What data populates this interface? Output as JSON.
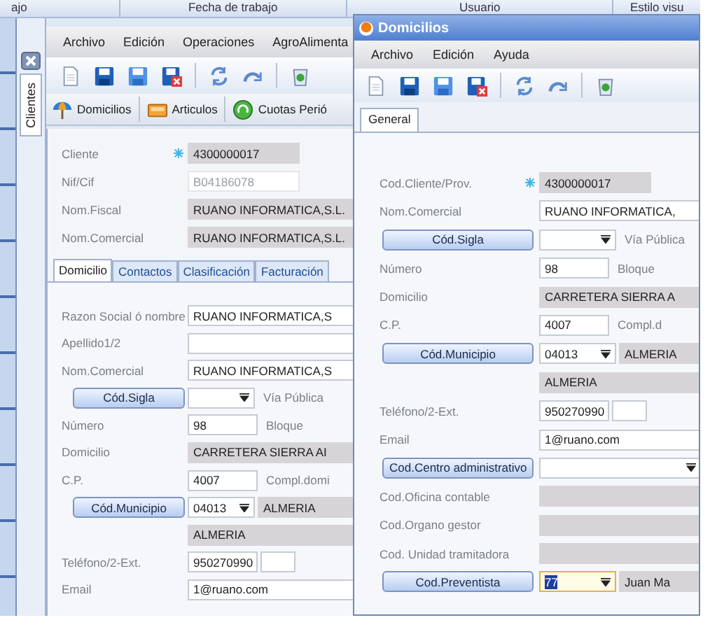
{
  "top_bar": {
    "columns": [
      "ajo",
      "Fecha de trabajo",
      "Usuario",
      "Estilo visu"
    ]
  },
  "side_tab": {
    "label": "Clientes"
  },
  "main_window": {
    "menu": [
      "Archivo",
      "Edición",
      "Operaciones",
      "AgroAlimenta"
    ],
    "shortcuts": [
      "Domicilios",
      "Articulos",
      "Cuotas Perió"
    ],
    "header_rows": [
      {
        "kind": "required",
        "label": "Cliente",
        "fields": [
          {
            "kind": "medium",
            "readonly": true,
            "disabled": false,
            "focused": false,
            "value": "4300000017"
          }
        ]
      },
      {
        "kind": "label",
        "label": "Nif/Cif",
        "fields": [
          {
            "kind": "medium",
            "readonly": false,
            "disabled": true,
            "focused": false,
            "value": "B04186078"
          }
        ]
      },
      {
        "kind": "label",
        "label": "Nom.Fiscal",
        "fields": [
          {
            "kind": "long",
            "readonly": true,
            "disabled": false,
            "focused": false,
            "value": "RUANO INFORMATICA,S.L."
          }
        ]
      },
      {
        "kind": "label",
        "label": "Nom.Comercial",
        "fields": [
          {
            "kind": "long",
            "readonly": true,
            "disabled": false,
            "focused": false,
            "value": "RUANO INFORMATICA,S.L."
          }
        ]
      }
    ],
    "tabs": [
      {
        "label": "Domicilio",
        "selected": true
      },
      {
        "label": "Contactos",
        "selected": false
      },
      {
        "label": "Clasificación",
        "selected": false
      },
      {
        "label": "Facturación",
        "selected": false
      }
    ],
    "rows": [
      {
        "kind": "label",
        "label": "Razon Social ó nombre",
        "fields": [
          {
            "kind": "long",
            "readonly": false,
            "disabled": false,
            "focused": false,
            "value": "RUANO INFORMATICA,S"
          }
        ]
      },
      {
        "kind": "label",
        "label": "Apellido1/2",
        "fields": [
          {
            "kind": "long",
            "readonly": false,
            "disabled": false,
            "focused": false
          }
        ]
      },
      {
        "kind": "label",
        "label": "Nom.Comercial",
        "fields": [
          {
            "kind": "long",
            "readonly": false,
            "disabled": false,
            "focused": false,
            "value": "RUANO INFORMATICA,S"
          }
        ]
      },
      {
        "kind": "button",
        "label": "Cód.Sigla",
        "fields": [
          {
            "kind": "dropdown",
            "readonly": false,
            "disabled": false,
            "focused": false
          }
        ],
        "note": "Vía Pública"
      },
      {
        "kind": "label",
        "label": "Número",
        "fields": [
          {
            "kind": "short",
            "readonly": false,
            "disabled": false,
            "focused": false,
            "value": "98"
          }
        ],
        "note": "Bloque"
      },
      {
        "kind": "label",
        "label": "Domicilio",
        "fields": [
          {
            "kind": "long",
            "readonly": true,
            "disabled": false,
            "focused": false,
            "value": "CARRETERA SIERRA AI"
          }
        ]
      },
      {
        "kind": "label",
        "label": "C.P.",
        "fields": [
          {
            "kind": "short",
            "readonly": false,
            "disabled": false,
            "focused": false,
            "value": "4007"
          }
        ],
        "note": "Compl.domi"
      },
      {
        "kind": "button",
        "label": "Cód.Municipio",
        "fields": [
          {
            "kind": "dropdown",
            "readonly": false,
            "disabled": false,
            "focused": false,
            "value": "04013"
          },
          {
            "kind": "long",
            "readonly": true,
            "disabled": false,
            "focused": false,
            "value": "ALMERIA"
          }
        ]
      },
      {
        "kind": "blank",
        "fields": [
          {
            "kind": "long",
            "readonly": true,
            "disabled": false,
            "focused": false,
            "value": "ALMERIA"
          }
        ]
      },
      {
        "kind": "label",
        "label": "Teléfono/2-Ext.",
        "fields": [
          {
            "kind": "short",
            "readonly": false,
            "disabled": false,
            "focused": false,
            "value": "950270990"
          },
          {
            "kind": "tiny",
            "readonly": false,
            "disabled": false,
            "focused": false
          }
        ]
      },
      {
        "kind": "label",
        "label": "Email",
        "fields": [
          {
            "kind": "long",
            "readonly": false,
            "disabled": false,
            "focused": false,
            "value": "1@ruano.com"
          }
        ]
      }
    ]
  },
  "front_window": {
    "title": "Domicilios",
    "menu": [
      "Archivo",
      "Edición",
      "Ayuda"
    ],
    "tabs": [
      {
        "label": "General",
        "selected": true
      }
    ],
    "rows": [
      {
        "kind": "required",
        "label": "Cod.Cliente/Prov.",
        "fields": [
          {
            "kind": "medium",
            "readonly": true,
            "disabled": false,
            "focused": false,
            "value": "4300000017"
          }
        ]
      },
      {
        "kind": "label",
        "label": "Nom.Comercial",
        "fields": [
          {
            "kind": "long",
            "readonly": false,
            "disabled": false,
            "focused": false,
            "value": "RUANO INFORMATICA,"
          }
        ]
      },
      {
        "kind": "button",
        "label": "Cód.Sigla",
        "fields": [
          {
            "kind": "dropdown",
            "readonly": false,
            "disabled": false,
            "focused": false
          }
        ],
        "note": "Vía Pública"
      },
      {
        "kind": "label",
        "label": "Número",
        "fields": [
          {
            "kind": "short",
            "readonly": false,
            "disabled": false,
            "focused": false,
            "value": "98"
          }
        ],
        "note": "Bloque"
      },
      {
        "kind": "label",
        "label": "Domicilio",
        "fields": [
          {
            "kind": "long",
            "readonly": true,
            "disabled": false,
            "focused": false,
            "value": "CARRETERA SIERRA A"
          }
        ]
      },
      {
        "kind": "label",
        "label": "C.P.",
        "fields": [
          {
            "kind": "short",
            "readonly": false,
            "disabled": false,
            "focused": false,
            "value": "4007"
          }
        ],
        "note": "Compl.d"
      },
      {
        "kind": "button",
        "label": "Cód.Municipio",
        "fields": [
          {
            "kind": "dropdown",
            "readonly": false,
            "disabled": false,
            "focused": false,
            "value": "04013"
          },
          {
            "kind": "long",
            "readonly": true,
            "disabled": false,
            "focused": false,
            "value": "ALMERIA"
          }
        ]
      },
      {
        "kind": "blank",
        "fields": [
          {
            "kind": "long",
            "readonly": true,
            "disabled": false,
            "focused": false,
            "value": "ALMERIA"
          }
        ]
      },
      {
        "kind": "label",
        "label": "Teléfono/2-Ext.",
        "fields": [
          {
            "kind": "short",
            "readonly": false,
            "disabled": false,
            "focused": false,
            "value": "950270990"
          },
          {
            "kind": "tiny",
            "readonly": false,
            "disabled": false,
            "focused": false
          }
        ]
      },
      {
        "kind": "label",
        "label": "Email",
        "fields": [
          {
            "kind": "long",
            "readonly": false,
            "disabled": false,
            "focused": false,
            "value": "1@ruano.com"
          }
        ]
      },
      {
        "kind": "button",
        "label": "Cod.Centro administrativo",
        "fields": [
          {
            "kind": "long-dropdown",
            "readonly": false,
            "disabled": false,
            "focused": false
          }
        ]
      },
      {
        "kind": "label",
        "label": "Cod.Oficina contable",
        "fields": [
          {
            "kind": "long",
            "readonly": true,
            "disabled": false,
            "focused": false
          }
        ]
      },
      {
        "kind": "label",
        "label": "Cod.Organo gestor",
        "fields": [
          {
            "kind": "long",
            "readonly": true,
            "disabled": false,
            "focused": false
          }
        ]
      },
      {
        "kind": "label",
        "label": "Cod. Unidad tramitadora",
        "fields": [
          {
            "kind": "long",
            "readonly": true,
            "disabled": false,
            "focused": false
          }
        ]
      },
      {
        "kind": "button",
        "label": "Cod.Preventista",
        "fields": [
          {
            "kind": "dropdown",
            "readonly": false,
            "disabled": false,
            "focused": true,
            "value": "77"
          },
          {
            "kind": "long",
            "readonly": true,
            "disabled": false,
            "focused": false,
            "value": "Juan Ma"
          }
        ]
      }
    ]
  }
}
